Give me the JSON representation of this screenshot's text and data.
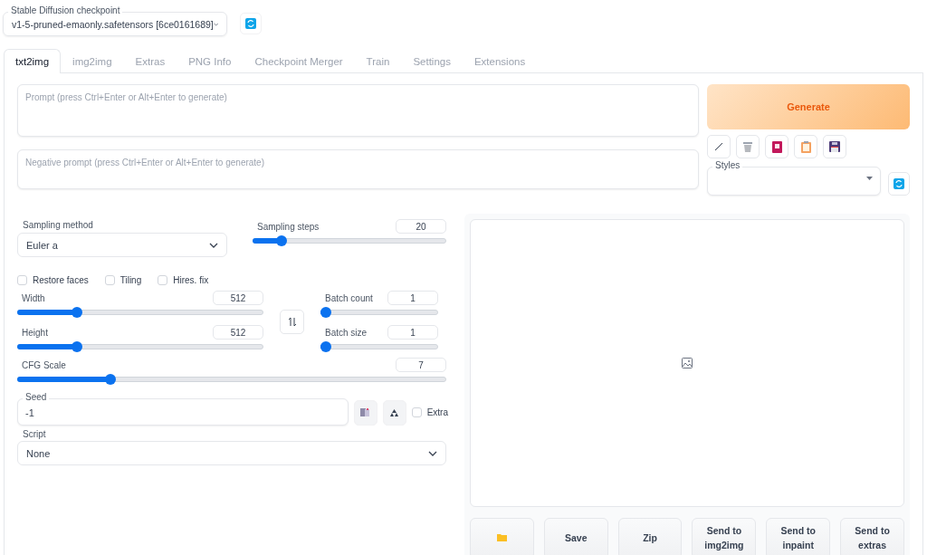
{
  "checkpoint": {
    "label": "Stable Diffusion checkpoint",
    "value": "v1-5-pruned-emaonly.safetensors [6ce0161689]"
  },
  "tabs": [
    {
      "label": "txt2img",
      "selected": true
    },
    {
      "label": "img2img",
      "selected": false
    },
    {
      "label": "Extras",
      "selected": false
    },
    {
      "label": "PNG Info",
      "selected": false
    },
    {
      "label": "Checkpoint Merger",
      "selected": false
    },
    {
      "label": "Train",
      "selected": false
    },
    {
      "label": "Settings",
      "selected": false
    },
    {
      "label": "Extensions",
      "selected": false
    }
  ],
  "prompt": {
    "placeholder": "Prompt (press Ctrl+Enter or Alt+Enter to generate)"
  },
  "negative_prompt": {
    "placeholder": "Negative prompt (press Ctrl+Enter or Alt+Enter to generate)"
  },
  "generate_button": "Generate",
  "styles": {
    "label": "Styles"
  },
  "sampling_method": {
    "label": "Sampling method",
    "value": "Euler a"
  },
  "sampling_steps": {
    "label": "Sampling steps",
    "value": "20",
    "level": 0.13
  },
  "checkboxes": [
    {
      "label": "Restore faces",
      "checked": false
    },
    {
      "label": "Tiling",
      "checked": false
    },
    {
      "label": "Hires. fix",
      "checked": false
    }
  ],
  "size_sliders": [
    {
      "label": "Width",
      "value": "512",
      "level": 0.23
    },
    {
      "label": "Height",
      "value": "512",
      "level": 0.23
    }
  ],
  "batch_sliders": [
    {
      "label": "Batch count",
      "value": "1",
      "level": 0
    },
    {
      "label": "Batch size",
      "value": "1",
      "level": 0
    }
  ],
  "cfg_scale": {
    "label": "CFG Scale",
    "value": "7",
    "level": 0.21
  },
  "seed": {
    "label": "Seed",
    "value": "-1"
  },
  "extra": {
    "label": "Extra",
    "checked": false
  },
  "script": {
    "label": "Script",
    "value": "None"
  },
  "output_buttons": [
    "Save",
    "Zip",
    "Send to img2img",
    "Send to inpaint",
    "Send to extras"
  ]
}
